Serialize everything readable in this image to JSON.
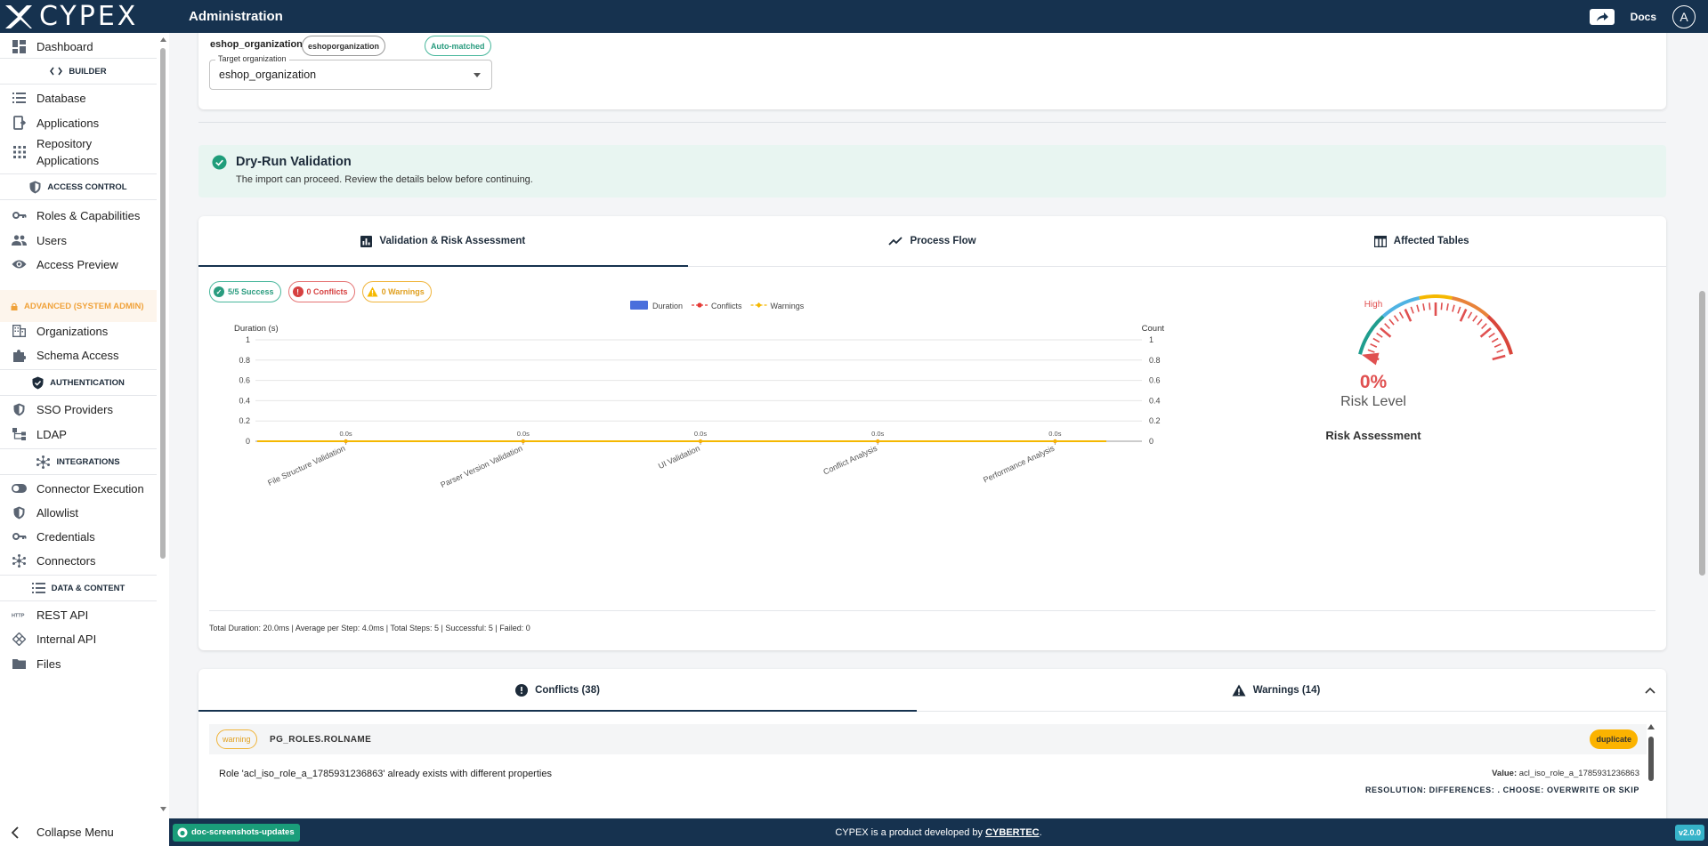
{
  "header": {
    "logo_text": "CYPEX",
    "title": "Administration",
    "docs_label": "Docs",
    "avatar_initial": "A"
  },
  "sidebar": {
    "items": [
      {
        "type": "item",
        "label": "Dashboard",
        "icon": "dashboard-icon"
      },
      {
        "type": "section",
        "label": "BUILDER",
        "icon": "code-icon"
      },
      {
        "type": "item",
        "label": "Database",
        "icon": "list-icon"
      },
      {
        "type": "item",
        "label": "Applications",
        "icon": "applications-icon"
      },
      {
        "type": "item",
        "label": "Repository Applications",
        "icon": "grid-icon"
      },
      {
        "type": "section",
        "label": "ACCESS CONTROL",
        "icon": "shield-icon"
      },
      {
        "type": "item",
        "label": "Roles & Capabilities",
        "icon": "key-icon"
      },
      {
        "type": "item",
        "label": "Users",
        "icon": "users-icon"
      },
      {
        "type": "item",
        "label": "Access Preview",
        "icon": "eye-icon"
      },
      {
        "type": "section-advanced",
        "label": "ADVANCED (SYSTEM ADMIN)",
        "icon": "lock-icon"
      },
      {
        "type": "item",
        "label": "Organizations",
        "icon": "building-icon"
      },
      {
        "type": "item",
        "label": "Schema Access",
        "icon": "puzzle-icon"
      },
      {
        "type": "section",
        "label": "AUTHENTICATION",
        "icon": "shield-check-icon"
      },
      {
        "type": "item",
        "label": "SSO Providers",
        "icon": "shield-icon"
      },
      {
        "type": "item",
        "label": "LDAP",
        "icon": "tree-icon"
      },
      {
        "type": "section",
        "label": "INTEGRATIONS",
        "icon": "hub-icon"
      },
      {
        "type": "item",
        "label": "Connector Execution",
        "icon": "toggle-icon"
      },
      {
        "type": "item",
        "label": "Allowlist",
        "icon": "shield-icon"
      },
      {
        "type": "item",
        "label": "Credentials",
        "icon": "key-icon"
      },
      {
        "type": "item",
        "label": "Connectors",
        "icon": "hub-icon"
      },
      {
        "type": "section",
        "label": "DATA & CONTENT",
        "icon": "list-icon"
      },
      {
        "type": "item",
        "label": "REST API",
        "icon": "http-icon"
      },
      {
        "type": "item",
        "label": "Internal API",
        "icon": "api-icon"
      },
      {
        "type": "item",
        "label": "Files",
        "icon": "folder-icon"
      }
    ],
    "collapse_label": "Collapse Menu"
  },
  "org": {
    "name": "eshop_organization",
    "chip": "eshoporganization",
    "matched": "Auto-matched",
    "target_label": "Target organization",
    "target_value": "eshop_organization"
  },
  "alert": {
    "title": "Dry-Run Validation",
    "text": "The import can proceed. Review the details below before continuing."
  },
  "validation": {
    "tabs": [
      "Validation & Risk Assessment",
      "Process Flow",
      "Affected Tables"
    ],
    "stats": {
      "success": "5/5 Success",
      "conflicts": "0 Conflicts",
      "warnings": "0 Warnings"
    },
    "summary": "Total Duration: 20.0ms | Average per Step: 4.0ms | Total Steps: 5 | Successful: 5 | Failed: 0"
  },
  "chart_data": {
    "type": "bar",
    "categories": [
      "File Structure Validation",
      "Parser Version Validation",
      "UI Validation",
      "Conflict Analysis",
      "Performance Analysis"
    ],
    "series": [
      {
        "name": "Duration",
        "values": [
          0,
          0,
          0,
          0,
          0
        ],
        "axis": "left",
        "color": "#4a6fdc"
      },
      {
        "name": "Conflicts",
        "values": [
          0,
          0,
          0,
          0,
          0
        ],
        "axis": "right",
        "color": "#e53935"
      },
      {
        "name": "Warnings",
        "values": [
          0,
          0,
          0,
          0,
          0
        ],
        "axis": "right",
        "color": "#f5b800"
      }
    ],
    "data_labels": [
      "0.0s",
      "0.0s",
      "0.0s",
      "0.0s",
      "0.0s"
    ],
    "ylabel": "Duration (s)",
    "y2label": "Count",
    "ylim": [
      0,
      1
    ],
    "yticks": [
      "0",
      "0.2",
      "0.4",
      "0.6",
      "0.8",
      "1"
    ],
    "grid": true,
    "legend_position": "top"
  },
  "gauge": {
    "level_label": "High",
    "percent": "0%",
    "value": 0,
    "caption": "Risk Level",
    "title": "Risk Assessment"
  },
  "conflicts": {
    "tab_conflicts": "Conflicts (38)",
    "tab_warnings": "Warnings (14)",
    "row": {
      "severity": "warning",
      "field": "PG_ROLES.ROLNAME",
      "type": "duplicate",
      "message": "Role 'acl_iso_role_a_1785931236863' already exists with different properties",
      "value_key": "Value:",
      "value": "acl_iso_role_a_1785931236863",
      "resolution": "RESOLUTION: DIFFERENCES: . CHOOSE: OVERWRITE OR SKIP"
    }
  },
  "footer": {
    "branch": "doc-screenshots-updates",
    "credit_prefix": "CYPEX is a product developed by ",
    "credit_link": "CYBERTEC",
    "credit_suffix": ".",
    "version": "v2.0.0"
  }
}
